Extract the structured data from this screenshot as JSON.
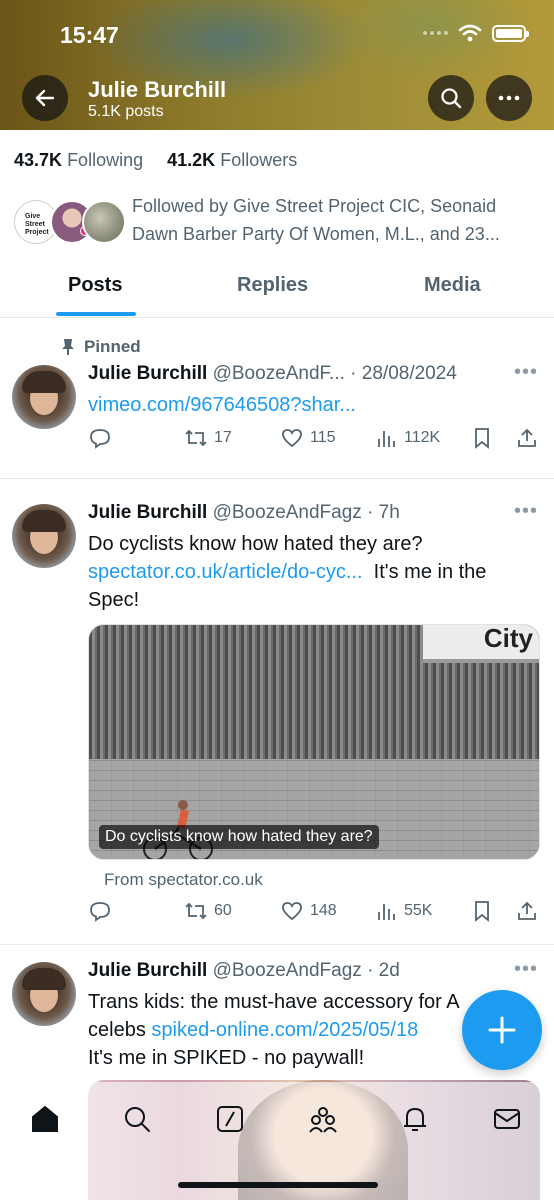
{
  "status_bar": {
    "time": "15:47"
  },
  "profile_header": {
    "name": "Julie Burchill",
    "post_count": "5.1K posts"
  },
  "stats": {
    "following_count": "43.7K",
    "following_label": "Following",
    "followers_count": "41.2K",
    "followers_label": "Followers"
  },
  "followed_by": {
    "line1": "Followed by Give Street Project CIC, Seonaid",
    "line2": "Dawn Barber Party Of Women, M.L., and 23...",
    "logo_text": "Give Street Project"
  },
  "tabs": [
    {
      "label": "Posts",
      "active": true
    },
    {
      "label": "Replies",
      "active": false
    },
    {
      "label": "Media",
      "active": false
    }
  ],
  "tweets": [
    {
      "pinned_label": "Pinned",
      "name": "Julie Burchill",
      "meta": "@BoozeAndF... · 28/08/2024",
      "link": "vimeo.com/967646508?shar...",
      "reposts": "17",
      "likes": "115",
      "views": "112K"
    },
    {
      "name": "Julie Burchill",
      "meta": "@BoozeAndFagz · 7h",
      "text_line1": "Do cyclists know how hated they are?",
      "link": "spectator.co.uk/article/do-cyc...",
      "text_after_link": "  It's me in the",
      "text_line3": "Spec!",
      "media_sign": "City",
      "media_caption": "Do cyclists know how hated they are?",
      "from_label": "From spectator.co.uk",
      "reposts": "60",
      "likes": "148",
      "views": "55K"
    },
    {
      "name": "Julie Burchill",
      "meta": "@BoozeAndFagz · 2d",
      "text_line1": "Trans kids: the must-have accessory for A",
      "text_line2_prefix": "celebs ",
      "link": "spiked-online.com/2025/05/18",
      "text_line3": "It's me in SPIKED - no paywall!"
    }
  ],
  "colors": {
    "accent": "#1d9bf0",
    "secondary_text": "#536471"
  }
}
